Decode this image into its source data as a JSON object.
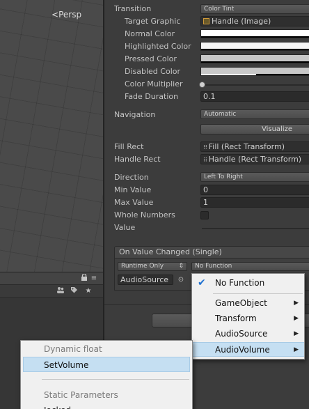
{
  "scene": {
    "camera_label": "Persp",
    "gizmo_symbol": "<"
  },
  "inspector": {
    "transition": {
      "label": "Transition",
      "value": "Color Tint"
    },
    "target_graphic": {
      "label": "Target Graphic",
      "value": "Handle (Image)"
    },
    "normal_color": {
      "label": "Normal Color",
      "color": "#ffffff"
    },
    "highlighted_color": {
      "label": "Highlighted Color",
      "color": "#f5f5f5"
    },
    "pressed_color": {
      "label": "Pressed Color",
      "color": "#c8c8c8"
    },
    "disabled_color": {
      "label": "Disabled Color",
      "color": "#c8c8c8"
    },
    "color_multiplier": {
      "label": "Color Multiplier"
    },
    "fade_duration": {
      "label": "Fade Duration",
      "value": "0.1"
    },
    "navigation": {
      "label": "Navigation",
      "value": "Automatic",
      "visualize_label": "Visualize"
    },
    "fill_rect": {
      "label": "Fill Rect",
      "value": "Fill (Rect Transform)"
    },
    "handle_rect": {
      "label": "Handle Rect",
      "value": "Handle (Rect Transform)"
    },
    "direction": {
      "label": "Direction",
      "value": "Left To Right"
    },
    "min_value": {
      "label": "Min Value",
      "value": "0"
    },
    "max_value": {
      "label": "Max Value",
      "value": "1"
    },
    "whole_numbers": {
      "label": "Whole Numbers",
      "checked": false
    },
    "value": {
      "label": "Value"
    },
    "event": {
      "header": "On Value Changed (Single)",
      "runtime_label": "Runtime Only",
      "function_label": "No Function",
      "target_object": "AudioSource"
    }
  },
  "function_menu": {
    "items": [
      {
        "label": "No Function",
        "checked": true
      },
      {
        "label": "GameObject",
        "submenu": true
      },
      {
        "label": "Transform",
        "submenu": true
      },
      {
        "label": "AudioSource",
        "submenu": true
      },
      {
        "label": "AudioVolume",
        "submenu": true,
        "highlighted": true
      }
    ]
  },
  "sub_menu": {
    "dynamic_header": "Dynamic float",
    "dynamic_item": "SetVolume",
    "static_header": "Static Parameters",
    "static_item_partial": "Iocked..."
  },
  "colors": {
    "menu_highlight": "#c5dff2",
    "check_blue": "#1e70d0"
  }
}
